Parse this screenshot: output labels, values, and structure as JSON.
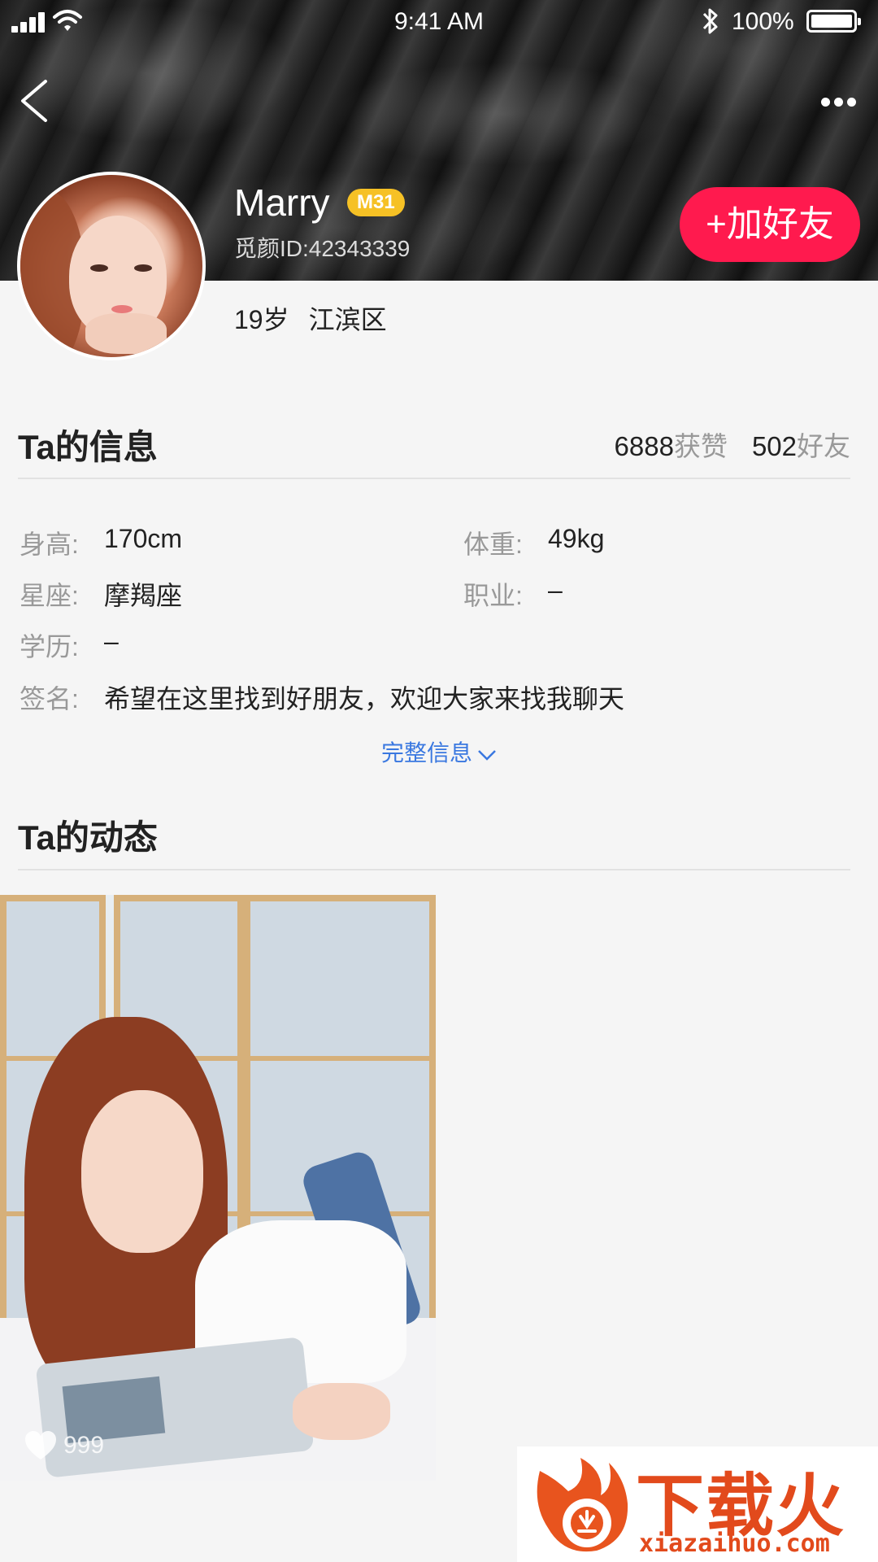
{
  "status_bar": {
    "time": "9:41 AM",
    "battery_percent": "100%",
    "battery_level": 1.0,
    "icons": [
      "signal-icon",
      "wifi-icon",
      "bluetooth-icon",
      "battery-icon"
    ]
  },
  "nav": {
    "back_icon": "chevron-left-icon",
    "more_icon": "more-dots-icon"
  },
  "profile": {
    "name": "Marry",
    "level_badge": "M31",
    "user_id": "觅颜ID:42343339",
    "age": "19岁",
    "area": "江滨区",
    "add_friend_label": "+加好友"
  },
  "info_section": {
    "title": "Ta的信息",
    "likes_count": "6888",
    "likes_label": "获赞",
    "friends_count": "502",
    "friends_label": "好友",
    "height_label": "身高:",
    "height_value": "170cm",
    "weight_label": "体重:",
    "weight_value": "49kg",
    "zodiac_label": "星座:",
    "zodiac_value": "摩羯座",
    "job_label": "职业:",
    "job_value": "–",
    "education_label": "学历:",
    "education_value": "–",
    "signature_label": "签名:",
    "signature_value": "希望在这里找到好朋友，欢迎大家来找我聊天",
    "full_info_link": "完整信息"
  },
  "posts_section": {
    "title": "Ta的动态",
    "posts": [
      {
        "likes": "999",
        "like_icon": "heart-outline-icon"
      }
    ]
  },
  "watermark": {
    "text": "下载火",
    "url": "xiazaihuo.com"
  },
  "colors": {
    "accent_red": "#ff1a4e",
    "badge_yellow": "#f6c125",
    "link_blue": "#3a78e0",
    "watermark_orange": "#e24a1c"
  }
}
